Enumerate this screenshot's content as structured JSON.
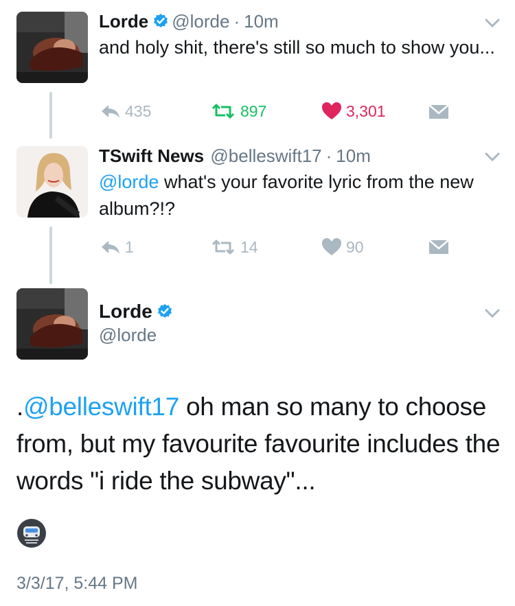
{
  "tweets": [
    {
      "name": "Lorde",
      "handle": "@lorde",
      "dot": "·",
      "time": "10m",
      "text": "and holy shit, there's still so much to show you...",
      "reply_count": "435",
      "retweet_count": "897",
      "like_count": "3,301",
      "retweet_color": "#17bf63",
      "like_color": "#e0245e"
    },
    {
      "name": "TSwift News",
      "handle": "@belleswift17",
      "dot": "·",
      "time": "10m",
      "mention": "@lorde",
      "text": " what's your favorite lyric from the new album?!?",
      "reply_count": "1",
      "retweet_count": "14",
      "like_count": "90"
    }
  ],
  "focus_tweet": {
    "name": "Lorde",
    "handle": "@lorde",
    "prefix": ".",
    "mention": "@belleswift17",
    "text": " oh man so many to choose from, but my favourite favourite includes the words \"i ride the subway\"...",
    "emoji": "metro-icon",
    "timestamp": "3/3/17, 5:44 PM"
  },
  "colors": {
    "accent": "#1da1f2",
    "muted": "#657786",
    "icon_gray": "#aab8c2"
  }
}
